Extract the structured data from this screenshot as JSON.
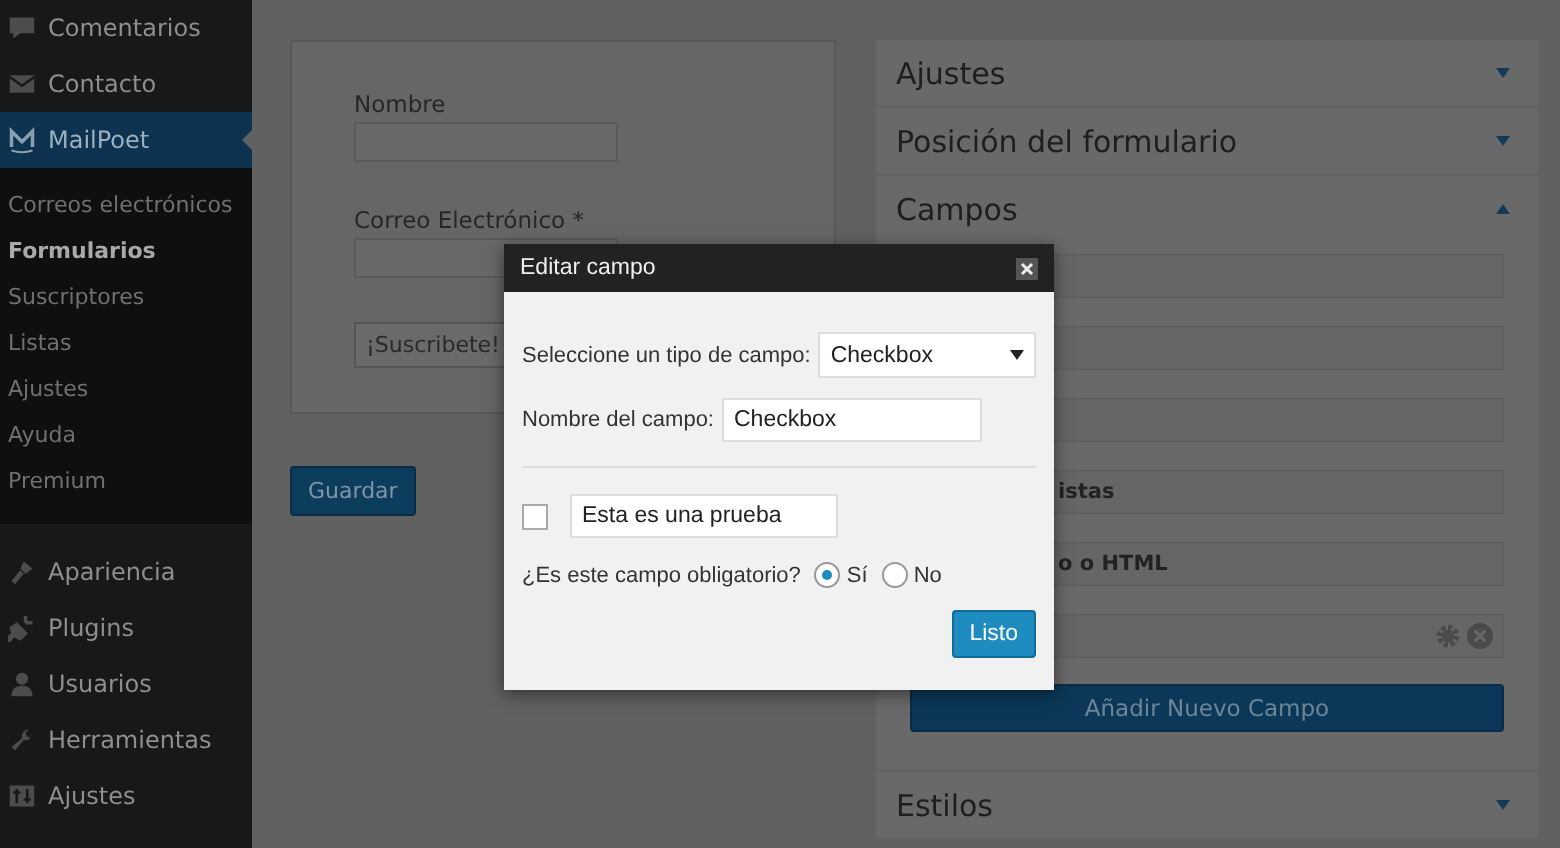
{
  "sidebar": {
    "menu_top": [
      {
        "label": "Comentarios",
        "kind": "comments",
        "selected": false
      },
      {
        "label": "Contacto",
        "kind": "mail",
        "selected": false
      },
      {
        "label": "MailPoet",
        "kind": "mailpoet",
        "selected": true
      }
    ],
    "submenu": [
      {
        "label": "Correos electrónicos",
        "selected": false
      },
      {
        "label": "Formularios",
        "selected": true
      },
      {
        "label": "Suscriptores",
        "selected": false
      },
      {
        "label": "Listas",
        "selected": false
      },
      {
        "label": "Ajustes",
        "selected": false
      },
      {
        "label": "Ayuda",
        "selected": false
      },
      {
        "label": "Premium",
        "selected": false
      }
    ],
    "menu_bottom": [
      {
        "label": "Apariencia",
        "kind": "brush",
        "selected": false
      },
      {
        "label": "Plugins",
        "kind": "plug",
        "selected": false
      },
      {
        "label": "Usuarios",
        "kind": "user",
        "selected": false
      },
      {
        "label": "Herramientas",
        "kind": "wrench",
        "selected": false
      },
      {
        "label": "Ajustes",
        "kind": "settings",
        "selected": false
      }
    ]
  },
  "form_preview": {
    "fields": [
      {
        "label": "Nombre"
      },
      {
        "label": "Correo Electrónico *"
      }
    ],
    "submit_button": "¡Suscribete!"
  },
  "save_button": "Guardar",
  "panels": [
    {
      "title": "Ajustes",
      "expanded": false
    },
    {
      "title": "Posición del formulario",
      "expanded": false
    },
    {
      "title": "Campos",
      "expanded": true,
      "fields": [
        {
          "kind": "field"
        },
        {
          "kind": "field"
        },
        {
          "kind": "field"
        },
        {
          "kind": "field",
          "label": "istas"
        },
        {
          "kind": "field",
          "label": "o o HTML"
        },
        {
          "kind": "field-actions"
        }
      ],
      "add_button": "Añadir Nuevo Campo"
    },
    {
      "title": "Estilos",
      "expanded": false
    }
  ],
  "modal": {
    "title": "Editar campo",
    "type_label": "Seleccione un tipo de campo:",
    "type_value": "Checkbox",
    "name_label": "Nombre del campo:",
    "name_value": "Checkbox",
    "checkbox": {
      "checked": false,
      "value": "Esta es una prueba"
    },
    "required": {
      "question": "¿Es este campo obligatorio?",
      "options": [
        {
          "label": "Sí",
          "selected": true
        },
        {
          "label": "No",
          "selected": false
        }
      ]
    },
    "done_button": "Listo"
  }
}
